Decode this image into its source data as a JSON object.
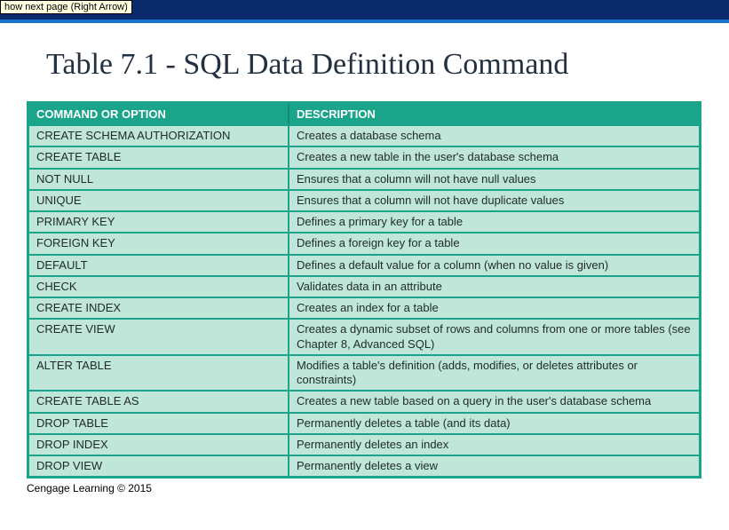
{
  "tooltip": "how next page (Right Arrow)",
  "title": "Table 7.1 - SQL Data Definition Command",
  "table": {
    "headers": {
      "col1": "COMMAND OR OPTION",
      "col2": "DESCRIPTION"
    },
    "rows": [
      {
        "cmd": "CREATE SCHEMA AUTHORIZATION",
        "desc": "Creates a database schema"
      },
      {
        "cmd": "CREATE TABLE",
        "desc": "Creates a new table in the user's database schema"
      },
      {
        "cmd": "NOT NULL",
        "desc": "Ensures that a column will not have null values"
      },
      {
        "cmd": "UNIQUE",
        "desc": "Ensures that a column will not have duplicate values"
      },
      {
        "cmd": "PRIMARY KEY",
        "desc": "Defines a primary key for a table"
      },
      {
        "cmd": "FOREIGN KEY",
        "desc": "Defines a foreign key for a table"
      },
      {
        "cmd": "DEFAULT",
        "desc": "Defines a default value for a column (when no value is given)"
      },
      {
        "cmd": "CHECK",
        "desc": "Validates data in an attribute"
      },
      {
        "cmd": "CREATE INDEX",
        "desc": "Creates an index for a table"
      },
      {
        "cmd": "CREATE VIEW",
        "desc": "Creates a dynamic subset of rows and columns from one or more tables (see Chapter 8, Advanced SQL)"
      },
      {
        "cmd": "ALTER TABLE",
        "desc": "Modifies a table's definition (adds, modifies, or deletes attributes or constraints)"
      },
      {
        "cmd": "CREATE TABLE AS",
        "desc": "Creates a new table based on a query in the user's database schema"
      },
      {
        "cmd": "DROP TABLE",
        "desc": "Permanently deletes a table (and its data)"
      },
      {
        "cmd": "DROP INDEX",
        "desc": "Permanently deletes an index"
      },
      {
        "cmd": "DROP VIEW",
        "desc": "Permanently deletes a view"
      }
    ]
  },
  "copyright": "Cengage Learning © 2015"
}
